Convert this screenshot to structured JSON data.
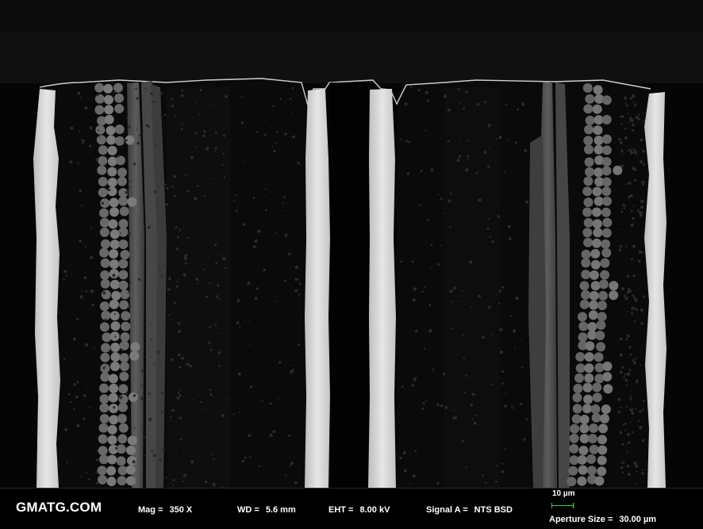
{
  "databar": {
    "brand": "GMATG.COM",
    "mag_label": "Mag =",
    "mag_value": "350 X",
    "wd_label": "WD =",
    "wd_value": "5.6 mm",
    "eht_label": "EHT =",
    "eht_value": "8.00 kV",
    "signal_label": "Signal A =",
    "signal_value": "NTS BSD",
    "scalebar_label": "10 µm",
    "aperture_label": "Aperture Size =",
    "aperture_value": "30.00 µm",
    "scalebar_color": "#2bd34a"
  }
}
